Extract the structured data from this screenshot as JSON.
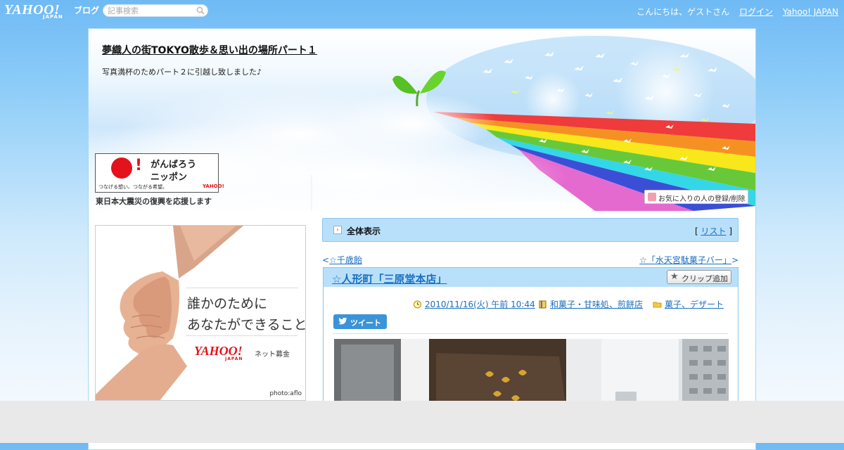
{
  "topbar": {
    "logo_text": "YAHOO!",
    "logo_sub": "JAPAN",
    "logo_blog": "ブログ",
    "search_placeholder": "記事検索",
    "greeting": "こんにちは、ゲストさん",
    "login_label": "ログイン",
    "yahoo_japan_label": "Yahoo! JAPAN"
  },
  "header": {
    "blog_title": "夢織人の街TOKYO散歩＆思い出の場所パート１",
    "blog_description": "写真満杯のためパート２に引越し致しました♪",
    "favorite_button": "お気に入りの人の登録/削除"
  },
  "sidebar": {
    "ganbaro": {
      "mark": "!",
      "line1": "がんばろう",
      "line2": "ニッポン",
      "tagline": "つなげる想い、つながる希望。",
      "logo": "YAHOO!",
      "caption": "東日本大震災の復興を応援します"
    },
    "ad": {
      "line1": "誰かのために",
      "line2": "あなたができること",
      "logo": "YAHOO!",
      "logo_sub": "JAPAN",
      "service": "ネット募金",
      "credit": "photo:aflo"
    }
  },
  "main": {
    "all_view_label": "全体表示",
    "list_open": "[",
    "list_label": "リスト",
    "list_close": "]",
    "prev_prefix": "<",
    "prev_label": "☆千歳飴",
    "next_label": "☆「水天宮駄菓子バー」",
    "next_suffix": ">",
    "article": {
      "title": "☆人形町「三原堂本店」",
      "clip_label": "クリップ追加",
      "date": "2010/11/16(火) 午前 10:44",
      "category": "和菓子・甘味処、煎餅店",
      "folder": "菓子、デザート",
      "tweet_label": "ツイート"
    }
  },
  "colors": {
    "sky_top": "#6fbaf5",
    "bar_blue": "#b9e0fa",
    "link": "#1a6fc0",
    "yahoo_red": "#e3121b",
    "twitter": "#3b94d9"
  },
  "icons": [
    "search-icon",
    "heart-icon",
    "arrow-right-icon",
    "star-icon",
    "clock-icon",
    "book-icon",
    "folder-icon",
    "twitter-bird-icon"
  ]
}
